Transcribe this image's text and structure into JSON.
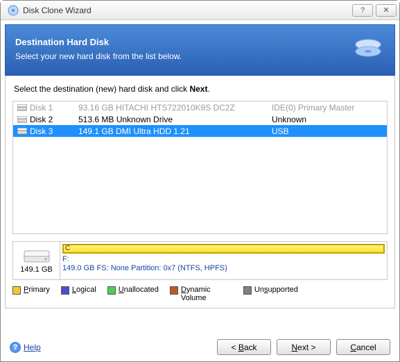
{
  "window": {
    "title": "Disk Clone Wizard",
    "help_tip": "?",
    "close_tip": "✕"
  },
  "header": {
    "title": "Destination Hard Disk",
    "subtitle": "Select your new hard disk from the list below."
  },
  "instruction_prefix": "Select the destination (new) hard disk and click ",
  "instruction_bold": "Next",
  "instruction_suffix": ".",
  "disks": [
    {
      "name": "Disk 1",
      "info": "93.16 GB  HITACHI HTS722010K9S DC2Z",
      "conn": "IDE(0) Primary Master",
      "state": "disabled"
    },
    {
      "name": "Disk 2",
      "info": "513.6 MB  Unknown Drive",
      "conn": "Unknown",
      "state": "normal"
    },
    {
      "name": "Disk 3",
      "info": "149.1 GB  DMI Ultra HDD 1.21",
      "conn": "USB",
      "state": "selected"
    }
  ],
  "partition": {
    "size": "149.1 GB",
    "bar_letter": "C",
    "drive_letter": "F:",
    "details": "149.0 GB  FS: None Partition: 0x7 (NTFS, HPFS)"
  },
  "legend": {
    "primary": "Primary",
    "logical": "Logical",
    "unallocated": "Unallocated",
    "dynamic": "Dynamic Volume",
    "unsupported": "Unsupported"
  },
  "footer": {
    "help": "Help",
    "back": "Back",
    "next": "Next",
    "cancel": "Cancel"
  }
}
